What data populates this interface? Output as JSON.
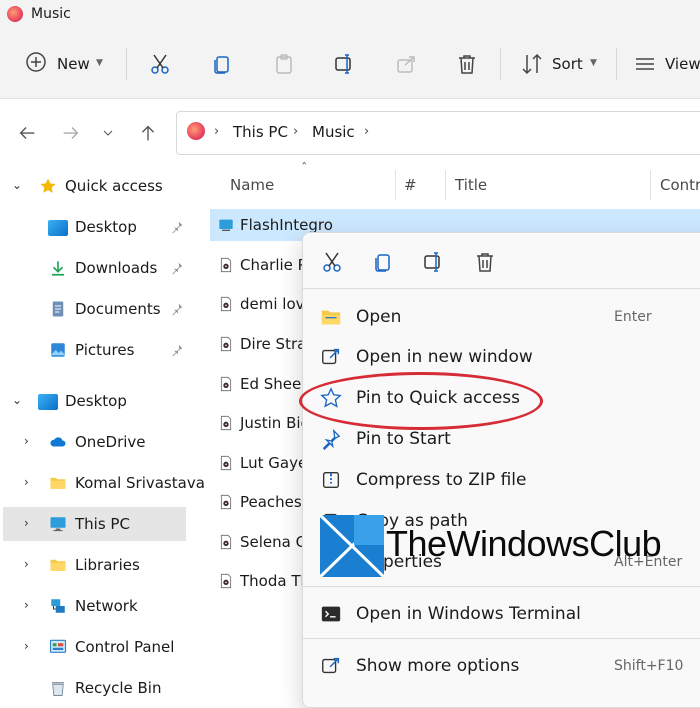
{
  "window": {
    "title": "Music"
  },
  "toolbar": {
    "new_label": "New",
    "sort_label": "Sort",
    "view_label": "View"
  },
  "address": {
    "crumbs": [
      "This PC",
      "Music"
    ]
  },
  "navpane": {
    "items": [
      {
        "label": "Quick access"
      },
      {
        "label": "Desktop"
      },
      {
        "label": "Downloads"
      },
      {
        "label": "Documents"
      },
      {
        "label": "Pictures"
      },
      {
        "label": "Desktop"
      },
      {
        "label": "OneDrive"
      },
      {
        "label": "Komal Srivastava"
      },
      {
        "label": "This PC"
      },
      {
        "label": "Libraries"
      },
      {
        "label": "Network"
      },
      {
        "label": "Control Panel"
      },
      {
        "label": "Recycle Bin"
      }
    ]
  },
  "filelist": {
    "columns": [
      "Name",
      "#",
      "Title",
      "Contri"
    ],
    "files": [
      {
        "name": "FlashIntegro"
      },
      {
        "name": "Charlie P"
      },
      {
        "name": "demi lova"
      },
      {
        "name": "Dire Strait"
      },
      {
        "name": "Ed Sheera"
      },
      {
        "name": "Justin Bie"
      },
      {
        "name": "Lut Gaye"
      },
      {
        "name": "Peaches-"
      },
      {
        "name": "Selena Go"
      },
      {
        "name": "Thoda Th"
      }
    ]
  },
  "context_menu": {
    "items": [
      {
        "label": "Open",
        "shortcut": "Enter"
      },
      {
        "label": "Open in new window",
        "shortcut": ""
      },
      {
        "label": "Pin to Quick access",
        "shortcut": ""
      },
      {
        "label": "Pin to Start",
        "shortcut": ""
      },
      {
        "label": "Compress to ZIP file",
        "shortcut": ""
      },
      {
        "label": "Copy as path",
        "shortcut": ""
      },
      {
        "label": "Properties",
        "shortcut": "Alt+Enter"
      },
      {
        "label": "Open in Windows Terminal",
        "shortcut": ""
      },
      {
        "label": "Show more options",
        "shortcut": "Shift+F10"
      }
    ]
  },
  "watermark": {
    "text": "TheWindowsClub"
  },
  "colors": {
    "accent": "#0067c0",
    "selection": "#cce8ff",
    "highlight_ring": "#d62c35",
    "folder": "#f7c948"
  }
}
